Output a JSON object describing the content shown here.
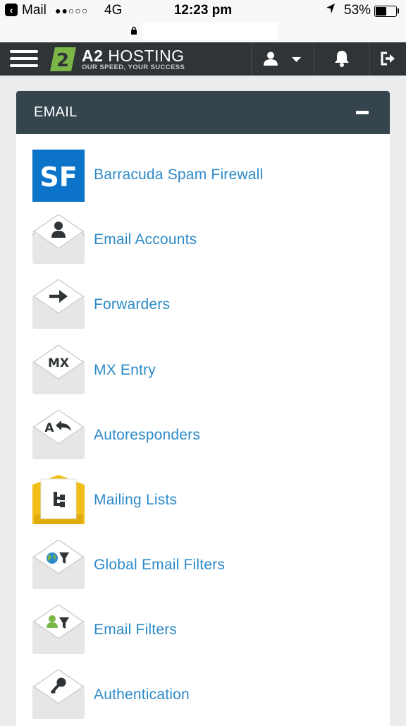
{
  "status_bar": {
    "back_glyph": "‹",
    "carrier": "Mail",
    "signal": "●●○○○",
    "network": "4G",
    "time": "12:23 pm",
    "battery": "53%",
    "location_icon": "location-arrow-icon"
  },
  "browser": {
    "url": ""
  },
  "header": {
    "brand_prefix": "A2",
    "brand_name": "HOSTING",
    "tagline": "OUR SPEED, YOUR SUCCESS"
  },
  "panel": {
    "title": "EMAIL",
    "items": [
      {
        "label": "Barracuda Spam Firewall",
        "icon": "spam-firewall-icon",
        "badge": "SF"
      },
      {
        "label": "Email Accounts",
        "icon": "email-accounts-icon"
      },
      {
        "label": "Forwarders",
        "icon": "forwarders-icon"
      },
      {
        "label": "MX Entry",
        "icon": "mx-entry-icon",
        "badge": "MX"
      },
      {
        "label": "Autoresponders",
        "icon": "autoresponders-icon",
        "badge": "A"
      },
      {
        "label": "Mailing Lists",
        "icon": "mailing-lists-icon"
      },
      {
        "label": "Global Email Filters",
        "icon": "global-email-filters-icon"
      },
      {
        "label": "Email Filters",
        "icon": "email-filters-icon"
      },
      {
        "label": "Authentication",
        "icon": "authentication-icon"
      }
    ]
  },
  "colors": {
    "nav_bg": "#2f3437",
    "panel_header": "#36444e",
    "link": "#2d8ac8",
    "logo_green": "#7ab648",
    "sf_blue": "#0b74c8",
    "list_yellow": "#f2bf1a"
  }
}
